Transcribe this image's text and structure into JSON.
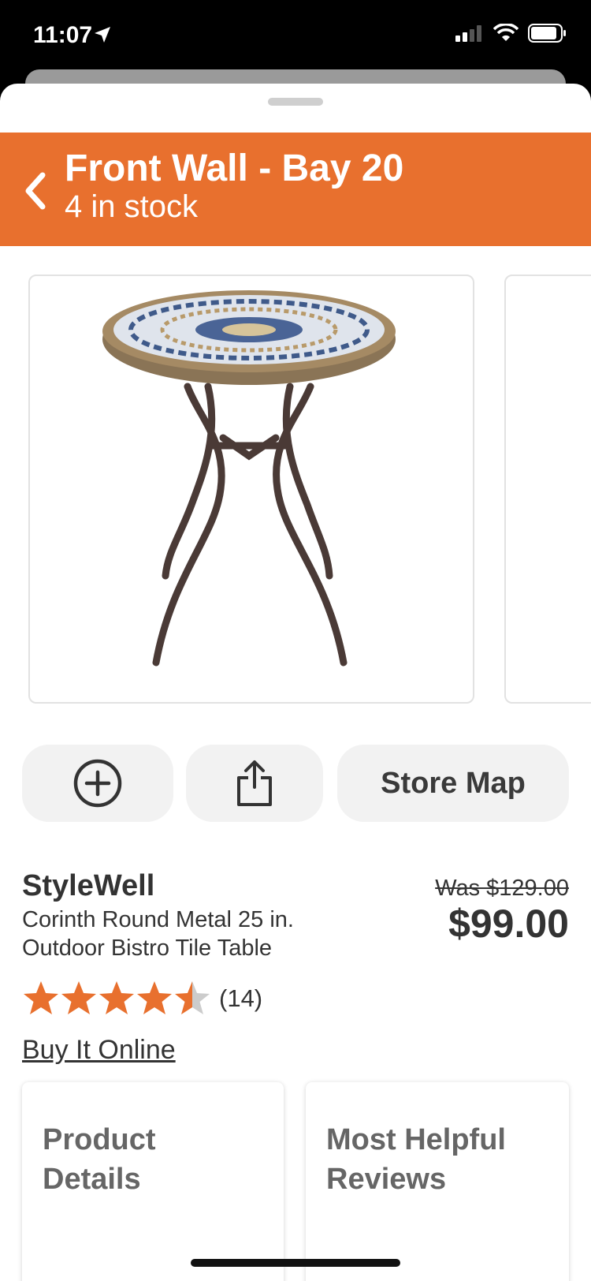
{
  "status_bar": {
    "time": "11:07"
  },
  "location": {
    "title": "Front Wall - Bay 20",
    "stock": "4 in stock"
  },
  "actions": {
    "store_map_label": "Store Map"
  },
  "product": {
    "brand": "StyleWell",
    "name": "Corinth Round Metal 25 in. Outdoor Bistro Tile Table",
    "was_price": "Was $129.00",
    "price": "$99.00",
    "rating_value": 4.5,
    "review_count": "(14)",
    "buy_online_label": "Buy It Online"
  },
  "cards": {
    "product_details": "Product Details",
    "most_helpful_reviews": "Most Helpful Reviews"
  },
  "colors": {
    "accent": "#e8702e",
    "star_filled": "#e8702e",
    "star_empty": "#cccccc"
  }
}
